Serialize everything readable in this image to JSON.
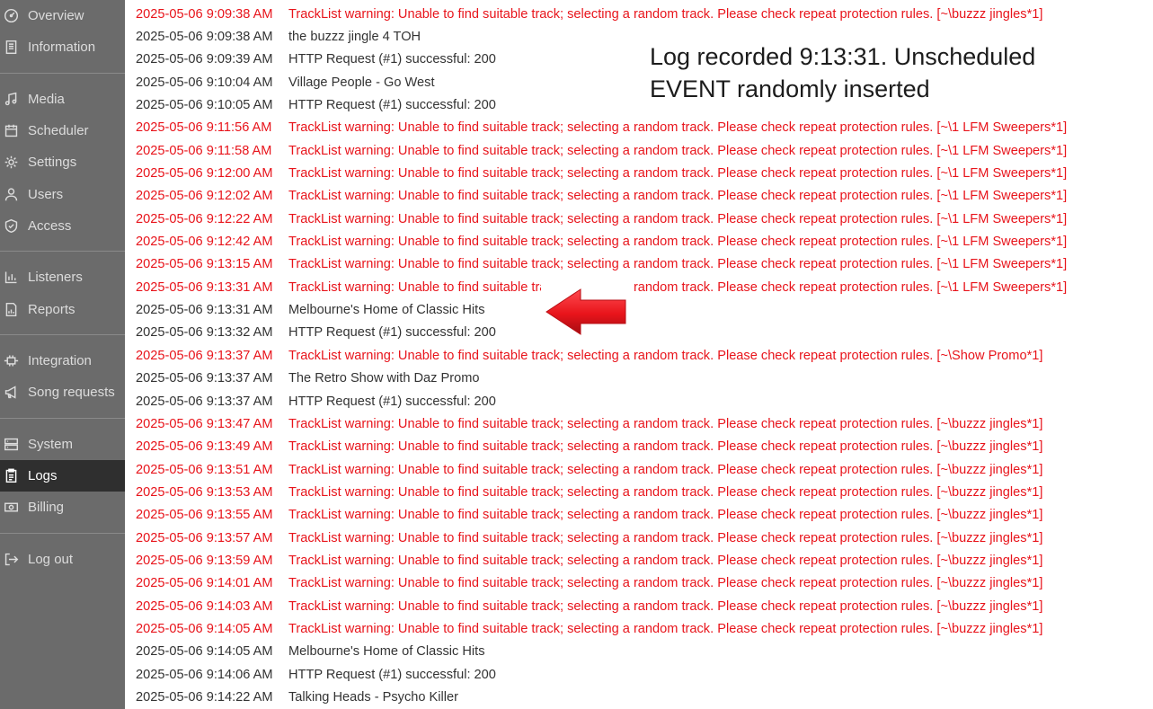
{
  "sidebar": {
    "items": [
      {
        "key": "overview",
        "label": "Overview",
        "icon": "gauge-icon"
      },
      {
        "key": "information",
        "label": "Information",
        "icon": "document-icon"
      },
      {
        "key": "media",
        "label": "Media",
        "icon": "music-note-icon"
      },
      {
        "key": "scheduler",
        "label": "Scheduler",
        "icon": "calendar-icon"
      },
      {
        "key": "settings",
        "label": "Settings",
        "icon": "gear-icon"
      },
      {
        "key": "users",
        "label": "Users",
        "icon": "user-icon"
      },
      {
        "key": "access",
        "label": "Access",
        "icon": "shield-icon"
      },
      {
        "key": "listeners",
        "label": "Listeners",
        "icon": "bar-chart-icon"
      },
      {
        "key": "reports",
        "label": "Reports",
        "icon": "report-icon"
      },
      {
        "key": "integration",
        "label": "Integration",
        "icon": "plug-icon"
      },
      {
        "key": "song-requests",
        "label": "Song requests",
        "icon": "megaphone-icon"
      },
      {
        "key": "system",
        "label": "System",
        "icon": "server-icon"
      },
      {
        "key": "logs",
        "label": "Logs",
        "icon": "clipboard-icon",
        "active": true
      },
      {
        "key": "billing",
        "label": "Billing",
        "icon": "money-icon"
      },
      {
        "key": "logout",
        "label": "Log out",
        "icon": "logout-icon"
      }
    ]
  },
  "log": {
    "rows": [
      {
        "time": "2025-05-06 9:09:38 AM",
        "message": "TrackList warning: Unable to find suitable track; selecting a random track. Please check repeat protection rules. [~\\buzzz jingles*1]",
        "level": "warning"
      },
      {
        "time": "2025-05-06 9:09:38 AM",
        "message": "the buzzz jingle 4 TOH",
        "level": "info"
      },
      {
        "time": "2025-05-06 9:09:39 AM",
        "message": "HTTP Request (#1) successful: 200",
        "level": "info"
      },
      {
        "time": "2025-05-06 9:10:04 AM",
        "message": "Village People - Go West",
        "level": "info"
      },
      {
        "time": "2025-05-06 9:10:05 AM",
        "message": "HTTP Request (#1) successful: 200",
        "level": "info"
      },
      {
        "time": "2025-05-06 9:11:56 AM",
        "message": "TrackList warning: Unable to find suitable track; selecting a random track. Please check repeat protection rules. [~\\1 LFM Sweepers*1]",
        "level": "warning"
      },
      {
        "time": "2025-05-06 9:11:58 AM",
        "message": "TrackList warning: Unable to find suitable track; selecting a random track. Please check repeat protection rules. [~\\1 LFM Sweepers*1]",
        "level": "warning"
      },
      {
        "time": "2025-05-06 9:12:00 AM",
        "message": "TrackList warning: Unable to find suitable track; selecting a random track. Please check repeat protection rules. [~\\1 LFM Sweepers*1]",
        "level": "warning"
      },
      {
        "time": "2025-05-06 9:12:02 AM",
        "message": "TrackList warning: Unable to find suitable track; selecting a random track. Please check repeat protection rules. [~\\1 LFM Sweepers*1]",
        "level": "warning"
      },
      {
        "time": "2025-05-06 9:12:22 AM",
        "message": "TrackList warning: Unable to find suitable track; selecting a random track. Please check repeat protection rules. [~\\1 LFM Sweepers*1]",
        "level": "warning"
      },
      {
        "time": "2025-05-06 9:12:42 AM",
        "message": "TrackList warning: Unable to find suitable track; selecting a random track. Please check repeat protection rules. [~\\1 LFM Sweepers*1]",
        "level": "warning"
      },
      {
        "time": "2025-05-06 9:13:15 AM",
        "message": "TrackList warning: Unable to find suitable track; selecting a random track. Please check repeat protection rules. [~\\1 LFM Sweepers*1]",
        "level": "warning"
      },
      {
        "time": "2025-05-06 9:13:31 AM",
        "message": "TrackList warning: Unable to find suitable track; selecting a random track. Please check repeat protection rules. [~\\1 LFM Sweepers*1]",
        "level": "warning"
      },
      {
        "time": "2025-05-06 9:13:31 AM",
        "message": "Melbourne's Home of Classic Hits",
        "level": "info"
      },
      {
        "time": "2025-05-06 9:13:32 AM",
        "message": "HTTP Request (#1) successful: 200",
        "level": "info"
      },
      {
        "time": "2025-05-06 9:13:37 AM",
        "message": "TrackList warning: Unable to find suitable track; selecting a random track. Please check repeat protection rules. [~\\Show Promo*1]",
        "level": "warning"
      },
      {
        "time": "2025-05-06 9:13:37 AM",
        "message": "The Retro Show with Daz Promo",
        "level": "info"
      },
      {
        "time": "2025-05-06 9:13:37 AM",
        "message": "HTTP Request (#1) successful: 200",
        "level": "info"
      },
      {
        "time": "2025-05-06 9:13:47 AM",
        "message": "TrackList warning: Unable to find suitable track; selecting a random track. Please check repeat protection rules. [~\\buzzz jingles*1]",
        "level": "warning"
      },
      {
        "time": "2025-05-06 9:13:49 AM",
        "message": "TrackList warning: Unable to find suitable track; selecting a random track. Please check repeat protection rules. [~\\buzzz jingles*1]",
        "level": "warning"
      },
      {
        "time": "2025-05-06 9:13:51 AM",
        "message": "TrackList warning: Unable to find suitable track; selecting a random track. Please check repeat protection rules. [~\\buzzz jingles*1]",
        "level": "warning"
      },
      {
        "time": "2025-05-06 9:13:53 AM",
        "message": "TrackList warning: Unable to find suitable track; selecting a random track. Please check repeat protection rules. [~\\buzzz jingles*1]",
        "level": "warning"
      },
      {
        "time": "2025-05-06 9:13:55 AM",
        "message": "TrackList warning: Unable to find suitable track; selecting a random track. Please check repeat protection rules. [~\\buzzz jingles*1]",
        "level": "warning"
      },
      {
        "time": "2025-05-06 9:13:57 AM",
        "message": "TrackList warning: Unable to find suitable track; selecting a random track. Please check repeat protection rules. [~\\buzzz jingles*1]",
        "level": "warning"
      },
      {
        "time": "2025-05-06 9:13:59 AM",
        "message": "TrackList warning: Unable to find suitable track; selecting a random track. Please check repeat protection rules. [~\\buzzz jingles*1]",
        "level": "warning"
      },
      {
        "time": "2025-05-06 9:14:01 AM",
        "message": "TrackList warning: Unable to find suitable track; selecting a random track. Please check repeat protection rules. [~\\buzzz jingles*1]",
        "level": "warning"
      },
      {
        "time": "2025-05-06 9:14:03 AM",
        "message": "TrackList warning: Unable to find suitable track; selecting a random track. Please check repeat protection rules. [~\\buzzz jingles*1]",
        "level": "warning"
      },
      {
        "time": "2025-05-06 9:14:05 AM",
        "message": "TrackList warning: Unable to find suitable track; selecting a random track. Please check repeat protection rules. [~\\buzzz jingles*1]",
        "level": "warning"
      },
      {
        "time": "2025-05-06 9:14:05 AM",
        "message": "Melbourne's Home of Classic Hits",
        "level": "info"
      },
      {
        "time": "2025-05-06 9:14:06 AM",
        "message": "HTTP Request (#1) successful: 200",
        "level": "info"
      },
      {
        "time": "2025-05-06 9:14:22 AM",
        "message": "Talking Heads - Psycho Killer",
        "level": "info"
      }
    ]
  },
  "annotation": {
    "text": "Log recorded 9:13:31. Unscheduled EVENT randomly inserted",
    "arrow_icon": "red-arrow-left-icon",
    "arrow_color": "#e8141b"
  },
  "colors": {
    "sidebar_bg": "#6b6b6b",
    "sidebar_active_bg": "#2f2f2f",
    "warning_text": "#e8141b",
    "info_text": "#333333"
  }
}
